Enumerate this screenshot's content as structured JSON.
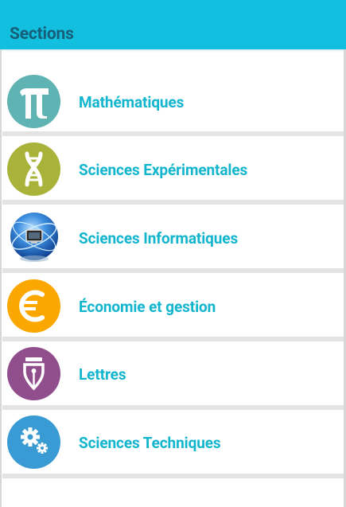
{
  "app_bar": {
    "title": "Sections"
  },
  "sections": [
    {
      "label": "Mathématiques",
      "icon": "pi-icon",
      "color": "#5fb3b3"
    },
    {
      "label": "Sciences Expérimentales",
      "icon": "dna-icon",
      "color": "#a9b33a"
    },
    {
      "label": "Sciences Informatiques",
      "icon": "computer-globe-icon",
      "color": "#1e5fb0"
    },
    {
      "label": "Économie et gestion",
      "icon": "euro-icon",
      "color": "#fba700"
    },
    {
      "label": "Lettres",
      "icon": "pen-nib-icon",
      "color": "#914e8d"
    },
    {
      "label": "Sciences Techniques",
      "icon": "gears-icon",
      "color": "#3a9bd4"
    }
  ],
  "colors": {
    "app_bar_bg": "#12bfdf",
    "title_color": "#175f78",
    "label_color": "#12b5ce",
    "divider": "#e3e3e3"
  }
}
